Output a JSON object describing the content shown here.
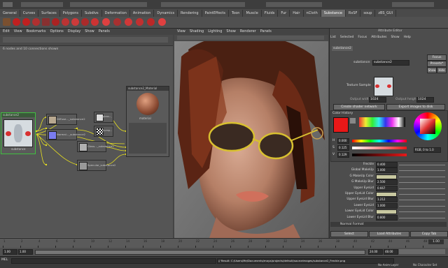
{
  "shelf": {
    "tabs": [
      "General",
      "Curves",
      "Surfaces",
      "Polygons",
      "Subdivs",
      "Deformation",
      "Animation",
      "Dynamics",
      "Rendering",
      "PaintEffects",
      "Toon",
      "Muscle",
      "Fluids",
      "Fur",
      "Hair",
      "nCloth",
      "Substance",
      "RxSF",
      "soup",
      "zBS_GUI"
    ],
    "active_tab": "Substance"
  },
  "hypershade": {
    "menu": [
      "Edit",
      "View",
      "Bookmarks",
      "Options",
      "Display",
      "Show",
      "Panels"
    ],
    "status": "6 nodes and 10 connections shown",
    "nodes": {
      "source": {
        "title": "substance2",
        "label": "substance"
      },
      "file1": {
        "title": "Diffuse..._substance2"
      },
      "file2": {
        "title": "Normal..._substance2"
      },
      "file3": {
        "title": "Gloss..._substance2"
      },
      "file4": {
        "title": "Specular_substance2"
      },
      "bump": {
        "title": "bump..._substance2"
      },
      "gloss_tex": {
        "title": "gloss..._sub"
      },
      "material": {
        "title": "substance2_Material",
        "label": "material"
      }
    }
  },
  "viewport": {
    "menu": [
      "View",
      "Shading",
      "Lighting",
      "Show",
      "Renderer",
      "Panels"
    ]
  },
  "attribute_editor": {
    "title": "Attribute Editor",
    "menu": [
      "List",
      "Selected",
      "Focus",
      "Attributes",
      "Show",
      "Help"
    ],
    "tab": "substance2",
    "node_label": "substance:",
    "node_value": "substance2",
    "focus_btn": "Focus",
    "presets_btn": "Presets*",
    "show_btn": "Show",
    "hide_btn": "Hide",
    "texture_sample": "Texture Sample",
    "output_width_lbl": "Output width",
    "output_width_val": "1024",
    "output_height_lbl": "Output height",
    "output_height_val": "1024",
    "create_shader_btn": "Create shader network",
    "export_btn": "Export images to disk",
    "color_history": "Color History",
    "h_lbl": "H",
    "h_val": "0.000",
    "s_lbl": "S",
    "s_val": "0.125",
    "v_lbl": "V",
    "v_val": "0.129",
    "rgb_mode": "RGB, 0 to 1.0",
    "attrs": [
      {
        "label": "Freckle",
        "value": "0.400"
      },
      {
        "label": "Global MakeUp",
        "value": "1.000"
      },
      {
        "label": "G MakeUp Color",
        "value": ""
      },
      {
        "label": "G MakeUp Blur",
        "value": "2.500"
      },
      {
        "label": "Upper EyeLid",
        "value": "0.667"
      },
      {
        "label": "Upper EyeLid Color",
        "value": ""
      },
      {
        "label": "Upper EyeLid Blur",
        "value": "1.212"
      },
      {
        "label": "Lower EyeLid",
        "value": "1.000"
      },
      {
        "label": "Lower EyeLid Color",
        "value": ""
      },
      {
        "label": "Lower EyeLid Blur",
        "value": "0.800"
      }
    ],
    "normal_format": "Normal Format",
    "select_btn": "Select",
    "load_attrs_btn": "Load Attributes",
    "copy_tab_btn": "Copy Tab",
    "colors": {
      "red": "#e81818",
      "accent": "#c8c8a0"
    }
  },
  "timeline": {
    "ticks": [
      "1",
      "2",
      "4",
      "6",
      "8",
      "10",
      "12",
      "14",
      "16",
      "18",
      "20",
      "22",
      "24",
      "26",
      "28",
      "30",
      "32",
      "34",
      "36",
      "38",
      "40",
      "42",
      "44",
      "46",
      "48"
    ],
    "current_frame": "1.00"
  },
  "range": {
    "start": "1.00",
    "start2": "1.00",
    "end": "24.00",
    "end2": "48.00",
    "anim_layer": "No Anim Layer",
    "char_set": "No Character Set"
  },
  "cmdline": {
    "mel": "MEL",
    "result": "// Result: C:/Users/Me/Documents/maya/projects/default/sourceimages/substance2_Freckle.png"
  }
}
